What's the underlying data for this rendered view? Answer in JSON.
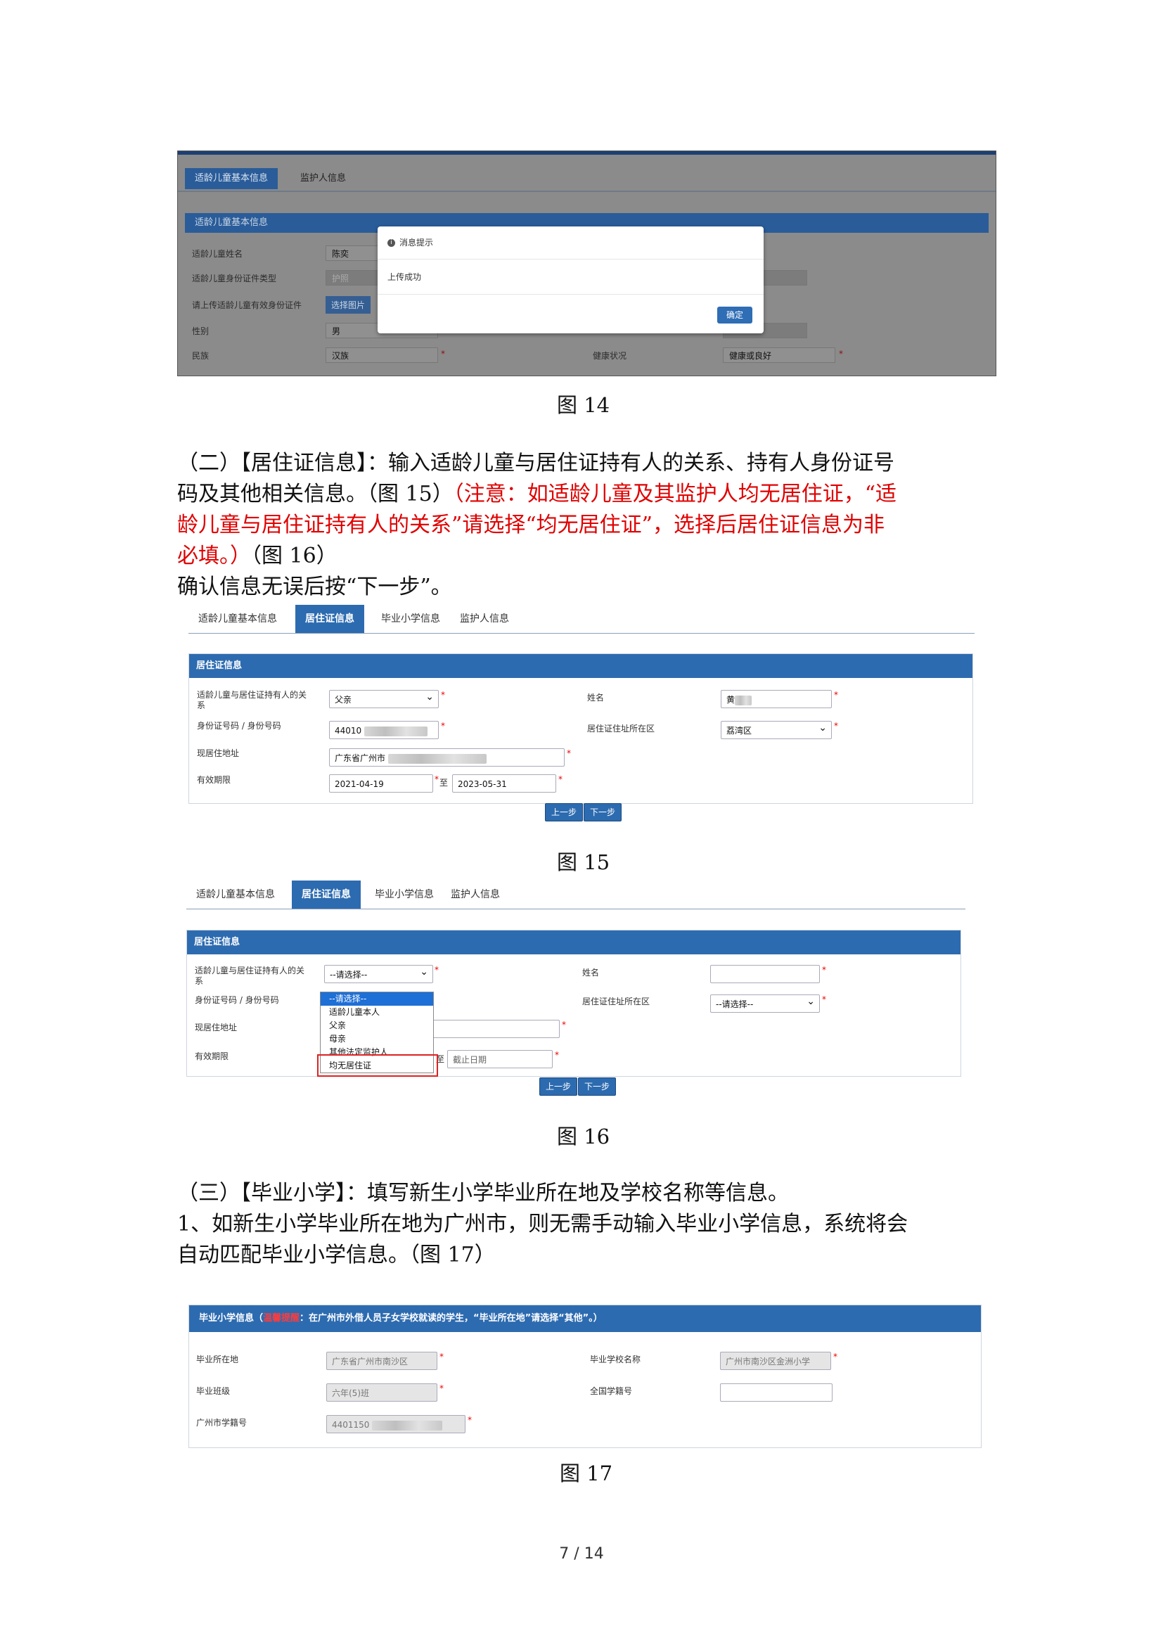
{
  "fig14": {
    "tabs": [
      "适龄儿童基本信息",
      "监护人信息"
    ],
    "section_title": "适龄儿童基本信息",
    "labels": {
      "name": "适龄儿童姓名",
      "id_type": "适龄儿童身份证件类型",
      "upload": "请上传适龄儿童有效身份证件",
      "gender": "性别",
      "ethnicity": "民族",
      "health": "健康状况"
    },
    "values": {
      "name": "陈奕",
      "id_type": "护照",
      "upload_button": "选择图片",
      "gender": "男",
      "ethnicity": "汉族",
      "health": "健康或良好"
    },
    "modal": {
      "title": "消息提示",
      "body": "上传成功",
      "ok": "确定"
    },
    "caption": "图 14"
  },
  "section2": {
    "line1": "（二）【居住证信息】：输入适龄儿童与居住证持有人的关系、持有人身份证号",
    "line2_black": "码及其他相关信息。（图 15）",
    "line2_red": "（注意：如适龄儿童及其监护人均无居住证，“适",
    "line3_red": "龄儿童与居住证持有人的关系”请选择“均无居住证”，选择后居住证信息为非",
    "line4_red": "必填。）",
    "line4_black": "（图 16）",
    "line5": "确认信息无误后按“下一步”。"
  },
  "fig15": {
    "tabs": [
      "适龄儿童基本信息",
      "居住证信息",
      "毕业小学信息",
      "监护人信息"
    ],
    "section_title": "居住证信息",
    "labels": {
      "relation_line1": "适龄儿童与居住证持有人的关",
      "relation_line2": "系",
      "id_number": "身份证号码 / 身份号码",
      "address": "现居住地址",
      "validity": "有效期限",
      "name": "姓名",
      "district": "居住证住址所在区"
    },
    "values": {
      "relation": "父亲",
      "id_number": "44010",
      "address": "广东省广州市",
      "start_date": "2021-04-19",
      "to": "至",
      "end_date": "2023-05-31",
      "name": "黄",
      "district": "荔湾区"
    },
    "buttons": {
      "prev": "上一步",
      "next": "下一步"
    },
    "caption": "图 15"
  },
  "fig16": {
    "tabs": [
      "适龄儿童基本信息",
      "居住证信息",
      "毕业小学信息",
      "监护人信息"
    ],
    "section_title": "居住证信息",
    "labels": {
      "relation_line1": "适龄儿童与居住证持有人的关",
      "relation_line2": "系",
      "id_number": "身份证号码 / 身份号码",
      "address": "现居住地址",
      "validity": "有效期限",
      "name": "姓名",
      "district": "居住证住址所在区"
    },
    "values": {
      "relation": "--请选择--",
      "district": "--请选择--",
      "to": "至",
      "end_placeholder": "截止日期"
    },
    "dropdown_options": [
      "--请选择--",
      "适龄儿童本人",
      "父亲",
      "母亲",
      "其他法定监护人",
      "均无居住证"
    ],
    "buttons": {
      "prev": "上一步",
      "next": "下一步"
    },
    "caption": "图 16"
  },
  "section3": {
    "line1": "（三）【毕业小学】：填写新生小学毕业所在地及学校名称等信息。",
    "line2": "1、如新生小学毕业所在地为广州市，则无需手动输入毕业小学信息，系统将会",
    "line3": "自动匹配毕业小学信息。（图 17）"
  },
  "fig17": {
    "header_prefix": "毕业小学信息（",
    "header_warn": "温馨提醒",
    "header_rest": "：在广州市外借人员子女学校就读的学生，“毕业所在地”请选择“其他”。）",
    "labels": {
      "location": "毕业所在地",
      "class": "毕业班级",
      "gz_student_id": "广州市学籍号",
      "school_name": "毕业学校名称",
      "national_id": "全国学籍号"
    },
    "values": {
      "location": "广东省广州市南沙区",
      "class": "六年(5)班",
      "gz_student_id": "4401150",
      "school_name": "广州市南沙区金洲小学"
    },
    "caption": "图 17"
  },
  "page_number": "7 / 14"
}
